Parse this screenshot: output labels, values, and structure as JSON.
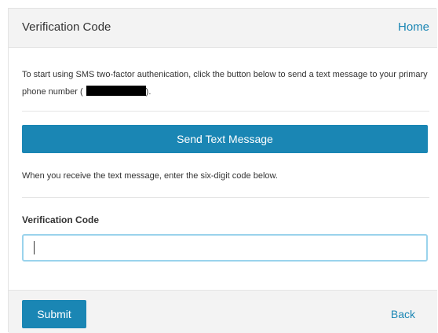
{
  "header": {
    "title": "Verification Code",
    "home_label": "Home"
  },
  "intro": {
    "text_before": "To start using SMS two-factor authenication, click the button below to send a text message to your primary phone number (",
    "text_after": ")."
  },
  "send_button": {
    "label": "Send Text Message"
  },
  "receive_instruction": "When you receive the text message, enter the six-digit code below.",
  "verification_field": {
    "label": "Verification Code",
    "value": "",
    "placeholder": ""
  },
  "footer": {
    "submit_label": "Submit",
    "back_label": "Back"
  },
  "colors": {
    "accent": "#1a86b4",
    "header_bg": "#f3f3f3",
    "input_focus_border": "#9ad3ec",
    "text": "#333333"
  }
}
